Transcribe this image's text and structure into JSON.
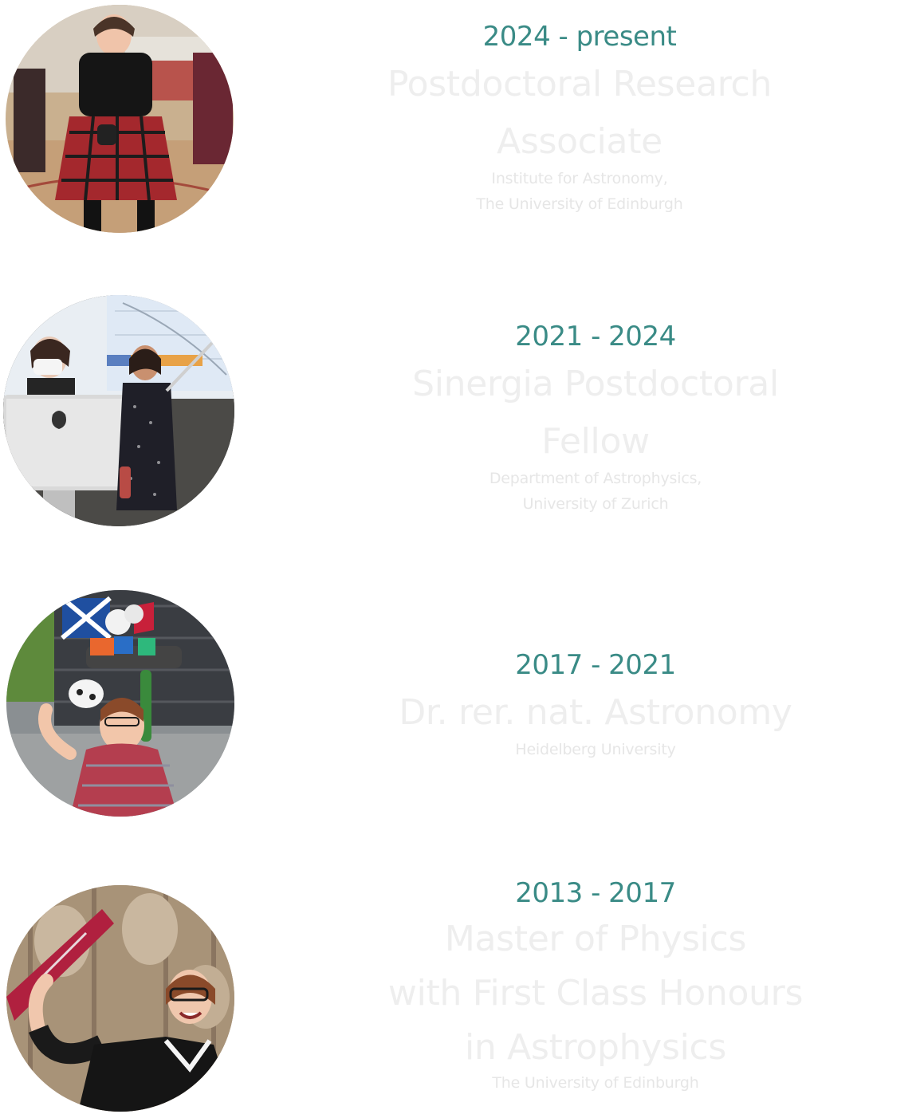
{
  "entries": [
    {
      "years": "2024 - present",
      "title_lines": [
        "Postdoctoral Research",
        "Associate"
      ],
      "institution_lines": [
        "Institute for Astronomy,",
        "The University of Edinburgh"
      ],
      "photo_icon": "photo-scottish-dance-icon"
    },
    {
      "years": "2021 - 2024",
      "title_lines": [
        "Sinergia Postdoctoral",
        "Fellow"
      ],
      "institution_lines": [
        "Department of Astrophysics,",
        "University of Zurich"
      ],
      "photo_icon": "photo-lecture-presentation-icon"
    },
    {
      "years": "2017 - 2021",
      "title_lines": [
        "Dr. rer. nat. Astronomy"
      ],
      "institution_lines": [
        "Heidelberg University"
      ],
      "photo_icon": "photo-graduation-hat-icon"
    },
    {
      "years": "2013 - 2017",
      "title_lines": [
        "Master of Physics",
        "with First Class Honours",
        "in Astrophysics"
      ],
      "institution_lines": [
        "The University of Edinburgh"
      ],
      "photo_icon": "photo-graduation-scroll-icon"
    }
  ],
  "colors": {
    "accent": "#3a8b86",
    "title_text": "#eeeeee",
    "institution_text": "#e6e6e6"
  }
}
